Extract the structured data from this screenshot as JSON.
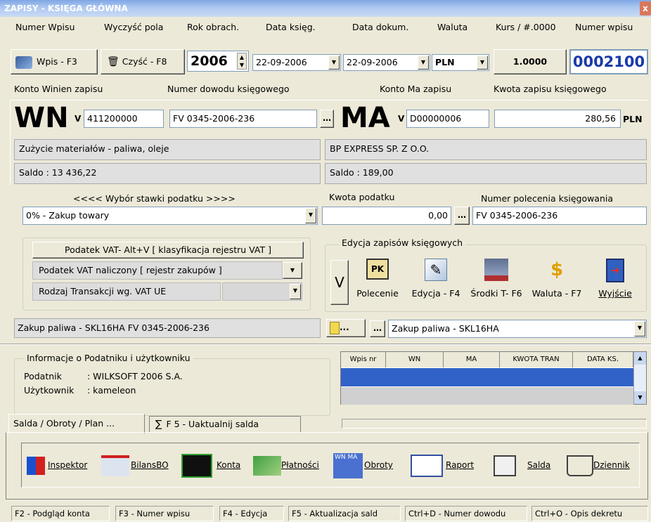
{
  "window": {
    "title": "ZAPISY - KSIĘGA GŁÓWNA"
  },
  "labels_row1": {
    "numer_wpisu": "Numer Wpisu",
    "wyczysc": "Wyczyść pola",
    "rok": "Rok obrach.",
    "data_ksieg": "Data księg.",
    "data_dokum": "Data dokum.",
    "waluta": "Waluta",
    "kurs": "Kurs  / #.0000",
    "numer_wpisu2": "Numer wpisu"
  },
  "toolbar": {
    "wpis_btn": "Wpis - F3",
    "czysc_btn": "Czyść - F8",
    "rok": "2006",
    "data_ksieg": "22-09-2006",
    "data_dokum": "22-09-2006",
    "waluta": "PLN",
    "kurs": "1.0000",
    "numer": "0002100"
  },
  "labels_row2": {
    "konto_winien": "Konto  Winien  zapisu",
    "numer_dowodu": "Numer dowodu księgowego",
    "konto_ma": "Konto   Ma  zapisu",
    "kwota": "Kwota zapisu księgowego"
  },
  "wn": {
    "title": "WN",
    "v": "V",
    "konto": "411200000",
    "dowod": "FV 0345-2006-236",
    "opis": "Zużycie materiałów - paliwa, oleje",
    "saldo": "Saldo : 13 436,22"
  },
  "ma": {
    "title": "MA",
    "v": "V",
    "konto": "D00000006",
    "kwota": "280,56",
    "waluta": "PLN",
    "opis": "BP EXPRESS SP. Z O.O.",
    "saldo": "Saldo : 189,00"
  },
  "podatek": {
    "wybor_label": "<<<<  Wybór stawki podatku  >>>>",
    "stawka": "0% - Zakup towary",
    "kwota_label": "Kwota podatku",
    "kwota": "0,00",
    "polecenie_label": "Numer polecenia księgowania",
    "polecenie": "FV 0345-2006-236"
  },
  "vat": {
    "title": "Podatek VAT- Alt+V [ klasyfikacja rejestru VAT ]",
    "rejestr": "Podatek VAT naliczony [ rejestr zakupów ]",
    "rodzaj": "Rodzaj Transakcji wg. VAT UE"
  },
  "edycja": {
    "title": "Edycja zapisów księgowych",
    "v": "V",
    "polecenie": "Polecenie",
    "edycja": "Edycja - F4",
    "srodki": "Środki T- F6",
    "waluta": "Waluta - F7",
    "wyjscie": "Wyjście"
  },
  "opis": {
    "tresc": "Zakup paliwa - SKL16HA FV 0345-2006-236",
    "combo": "Zakup paliwa - SKL16HA",
    "dots": "..."
  },
  "info": {
    "title": "Informacje o Podatniku i użytkowniku",
    "podatnik_label": "Podatnik",
    "podatnik": ": WILKSOFT 2006  S.A.",
    "uzytkownik_label": "Użytkownik",
    "uzytkownik": ": kameleon"
  },
  "grid": {
    "columns": [
      "Wpis nr",
      "WN",
      "MA",
      "KWOTA TRAN",
      "DATA KS."
    ]
  },
  "tabs": {
    "salda": "Salda / Obroty / Plan ...",
    "uaktualnij": "F 5 -  Uaktualnij salda"
  },
  "tools": {
    "inspektor": "Inspektor",
    "bilans": "BilansBO",
    "konta": "Konta",
    "platnosci": "Płatności",
    "obroty": "Obroty",
    "raport": "Raport",
    "salda": "Salda",
    "dziennik": "Dziennik"
  },
  "statusbar": [
    "F2 - Podgląd konta",
    "F3 - Numer wpisu",
    "F4 - Edycja",
    "F5 - Aktualizacja sald",
    "Ctrl+D - Numer dowodu",
    "Ctrl+O - Opis dekretu"
  ]
}
